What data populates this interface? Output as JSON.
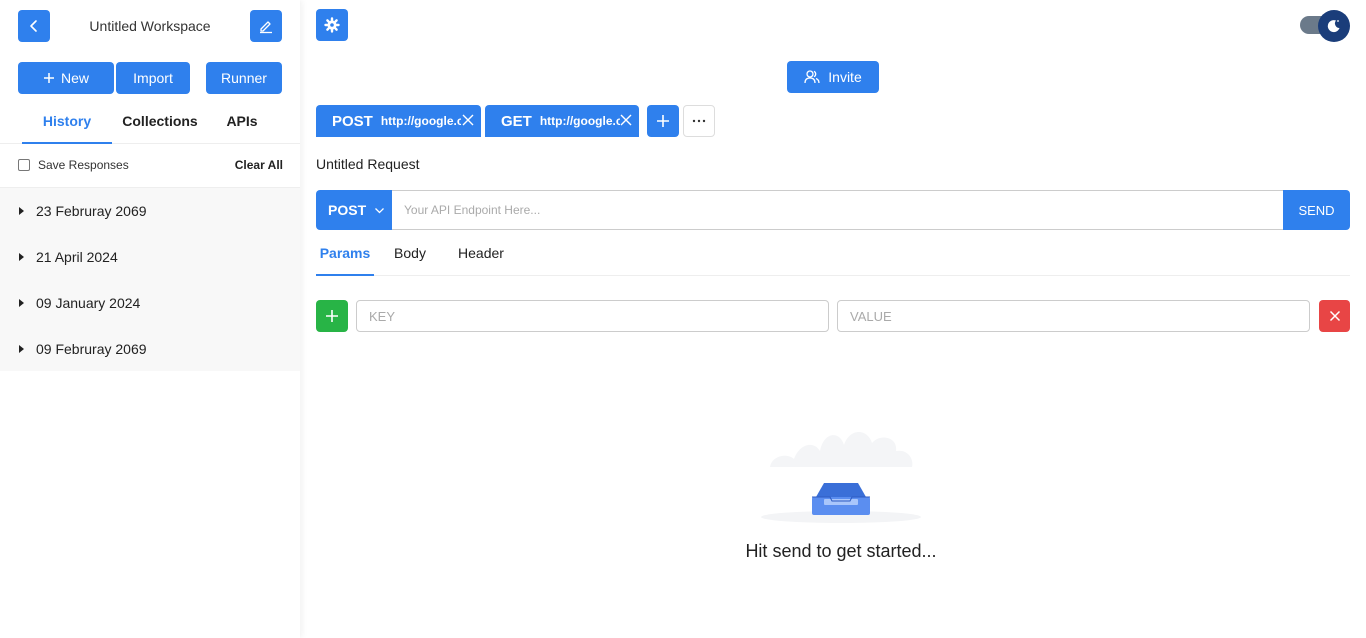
{
  "sidebar": {
    "workspace_title": "Untitled Workspace",
    "actions": {
      "new_label": "New",
      "import_label": "Import",
      "runner_label": "Runner"
    },
    "tabs": {
      "history": "History",
      "collections": "Collections",
      "apis": "APIs"
    },
    "save_responses_label": "Save Responses",
    "save_responses_checked": false,
    "clear_all_label": "Clear All",
    "history": [
      {
        "label": "23 Februray 2069"
      },
      {
        "label": "21 April 2024"
      },
      {
        "label": "09 January 2024"
      },
      {
        "label": "09 Februray 2069"
      }
    ]
  },
  "topbar": {
    "invite_label": "Invite",
    "theme_toggle_icon": "moon-icon"
  },
  "request_tabs": [
    {
      "method": "POST",
      "url": "http://google.com"
    },
    {
      "method": "GET",
      "url": "http://google.com"
    }
  ],
  "request": {
    "name": "Untitled Request",
    "method": "POST",
    "url_placeholder": "Your API Endpoint Here...",
    "url_value": "",
    "send_label": "SEND"
  },
  "sub_tabs": {
    "params": "Params",
    "body": "Body",
    "header": "Header"
  },
  "params": {
    "key_placeholder": "KEY",
    "value_placeholder": "VALUE"
  },
  "empty_state": {
    "message": "Hit send to get started..."
  },
  "colors": {
    "primary": "#2f80ed",
    "add_green": "#28b446",
    "delete_red": "#e84545",
    "toggle_knob": "#1a3d7a"
  }
}
